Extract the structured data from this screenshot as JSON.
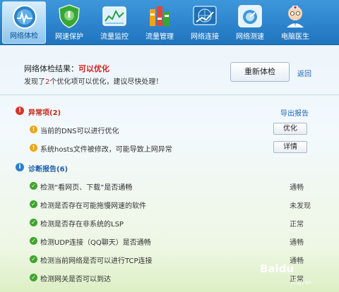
{
  "toolbar": {
    "items": [
      {
        "label": "网络体检",
        "icon": "network-checkup-icon",
        "active": true
      },
      {
        "label": "网速保护",
        "icon": "shield-icon",
        "active": false
      },
      {
        "label": "流量监控",
        "icon": "traffic-monitor-icon",
        "active": false
      },
      {
        "label": "流量管理",
        "icon": "traffic-manage-icon",
        "active": false
      },
      {
        "label": "网络连接",
        "icon": "network-connection-icon",
        "active": false
      },
      {
        "label": "网络测速",
        "icon": "speed-test-icon",
        "active": false
      },
      {
        "label": "电脑医生",
        "icon": "pc-doctor-icon",
        "active": false
      }
    ]
  },
  "result": {
    "title_prefix": "网络体检结果：",
    "title_status": "可以优化",
    "sub_pre": "发现了",
    "sub_num": "2",
    "sub_post": "个优化项可以优化，建议尽快处理！",
    "recheck_label": "重新体检",
    "back_label": "返回"
  },
  "abnormal": {
    "title": "异常项(2)",
    "export_label": "导出报告",
    "items": [
      {
        "label": "当前的DNS可以进行优化",
        "action": "优化"
      },
      {
        "label": "系统hosts文件被修改，可能导致上网异常",
        "action": "详情"
      }
    ]
  },
  "diagnosis": {
    "title": "诊断报告(6)",
    "items": [
      {
        "label": "检测“看网页、下载”是否通畅",
        "status": "通畅"
      },
      {
        "label": "检测是否存在可能拖慢网速的软件",
        "status": "未发现"
      },
      {
        "label": "检测是否存在非系统的LSP",
        "status": "正常"
      },
      {
        "label": "检测UDP连接（QQ聊天）是否通畅",
        "status": "通畅"
      },
      {
        "label": "检测当前网络是否可以进行TCP连接",
        "status": "通畅"
      },
      {
        "label": "检测网关是否可以到达",
        "status": "正常"
      }
    ]
  },
  "watermark": {
    "text": "Baidu",
    "sub": "jingyan"
  },
  "colors": {
    "toolbar": "#2e86cf",
    "alert_red": "#d21d1d",
    "warn_orange": "#f0a21c",
    "ok_green": "#3ea52c",
    "link_blue": "#1a66b8"
  }
}
